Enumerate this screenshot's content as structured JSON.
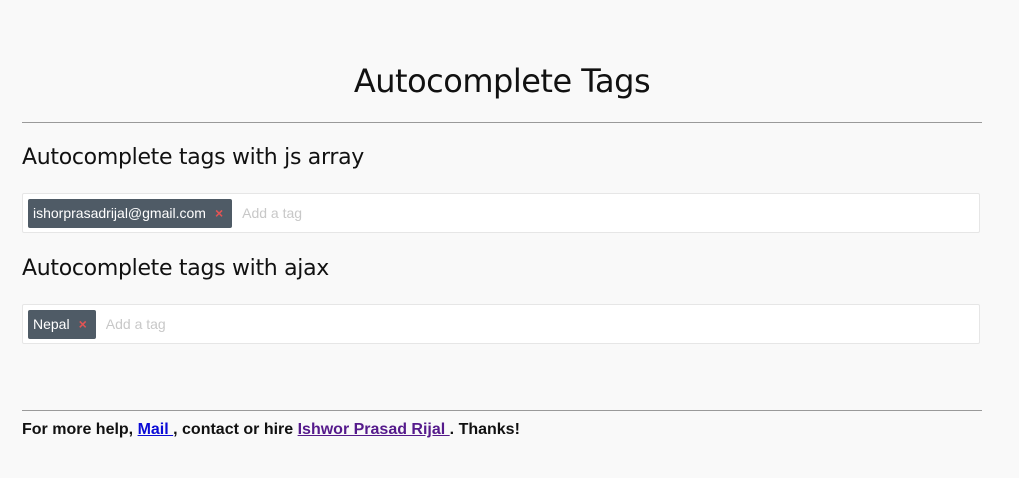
{
  "page": {
    "title": "Autocomplete Tags"
  },
  "sections": [
    {
      "heading": "Autocomplete tags with js array",
      "tags": [
        {
          "label": "ishorprasadrijal@gmail.com",
          "remove_symbol": "×"
        }
      ],
      "input_placeholder": "Add a tag",
      "input_value": ""
    },
    {
      "heading": "Autocomplete tags with ajax",
      "tags": [
        {
          "label": "Nepal",
          "remove_symbol": "×"
        }
      ],
      "input_placeholder": "Add a tag",
      "input_value": ""
    }
  ],
  "footer": {
    "prefix": "For more help, ",
    "mail_link": "Mail ",
    "middle": ", contact or hire ",
    "author_link": "Ishwor Prasad Rijal ",
    "suffix": ". Thanks!"
  },
  "colors": {
    "background": "#f9f9f9",
    "tag_background": "#4f5b66",
    "tag_remove": "#e35454",
    "link_unvisited": "#0b0bd6",
    "link_visited": "#551a8b"
  }
}
